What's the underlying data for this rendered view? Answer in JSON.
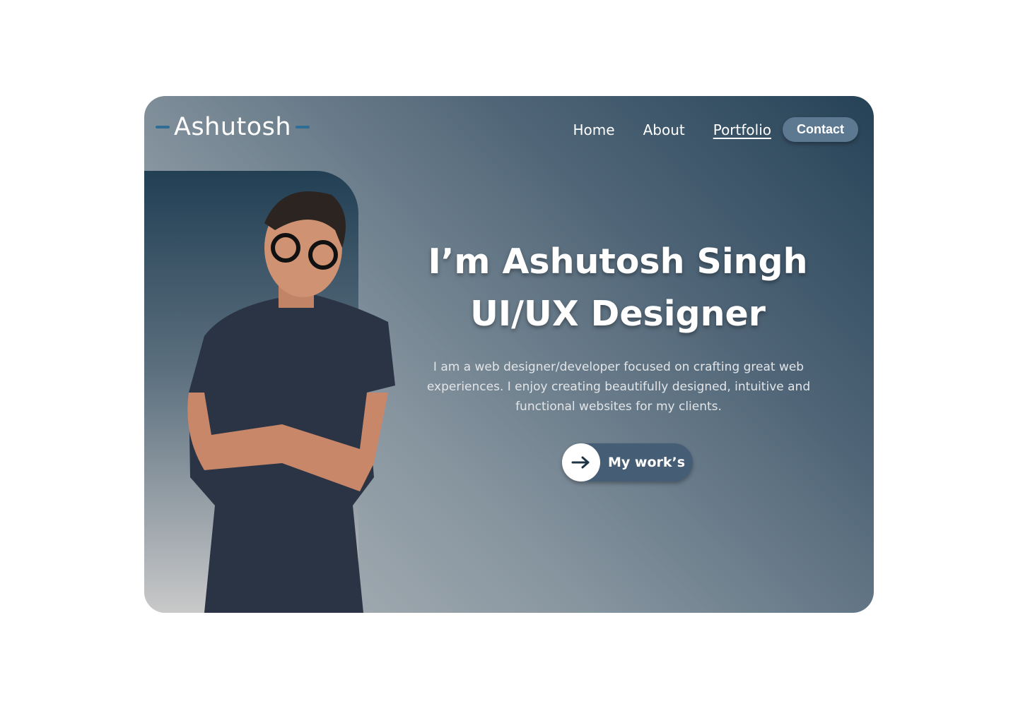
{
  "logo": "Ashutosh",
  "nav": {
    "items": [
      "Home",
      "About",
      "Portfolio"
    ],
    "contact": "Contact"
  },
  "hero": {
    "title_line1": "I’m Ashutosh Singh",
    "title_line2": "UI/UX Designer",
    "description": "I am a web designer/developer focused on crafting great web experiences. I enjoy creating beautifully designed, intuitive and functional websites for my clients.",
    "cta": "My work’s"
  },
  "colors": {
    "accent": "#2f6d96",
    "button": "#455d75",
    "contact": "#5d7891"
  }
}
